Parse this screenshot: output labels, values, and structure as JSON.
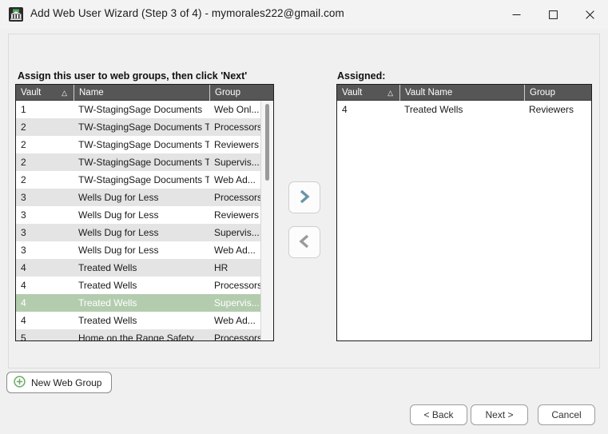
{
  "window": {
    "title": "Add Web User Wizard (Step 3 of 4) - mymorales222@gmail.com",
    "app_icon": "vault-building-icon",
    "controls": {
      "minimize": "minimize-icon",
      "maximize": "maximize-icon",
      "close": "close-icon"
    }
  },
  "left_panel": {
    "caption": "Assign this user to web groups, then click 'Next'",
    "columns": [
      "Vault",
      "Name",
      "Group"
    ],
    "sort_indicator": "△",
    "rows": [
      {
        "vault": "1",
        "name": "TW-StagingSage Documents",
        "group": "Web Onl...",
        "selected": false
      },
      {
        "vault": "2",
        "name": "TW-StagingSage Documents Test",
        "group": "Processors",
        "selected": false
      },
      {
        "vault": "2",
        "name": "TW-StagingSage Documents Test",
        "group": "Reviewers",
        "selected": false
      },
      {
        "vault": "2",
        "name": "TW-StagingSage Documents Test",
        "group": "Supervis...",
        "selected": false
      },
      {
        "vault": "2",
        "name": "TW-StagingSage Documents Test",
        "group": "Web Ad...",
        "selected": false
      },
      {
        "vault": "3",
        "name": "Wells Dug for Less",
        "group": "Processors",
        "selected": false
      },
      {
        "vault": "3",
        "name": "Wells Dug for Less",
        "group": "Reviewers",
        "selected": false
      },
      {
        "vault": "3",
        "name": "Wells Dug for Less",
        "group": "Supervis...",
        "selected": false
      },
      {
        "vault": "3",
        "name": "Wells Dug for Less",
        "group": "Web Ad...",
        "selected": false
      },
      {
        "vault": "4",
        "name": "Treated Wells",
        "group": "HR",
        "selected": false
      },
      {
        "vault": "4",
        "name": "Treated Wells",
        "group": "Processors",
        "selected": false
      },
      {
        "vault": "4",
        "name": "Treated Wells",
        "group": "Supervis...",
        "selected": true
      },
      {
        "vault": "4",
        "name": "Treated Wells",
        "group": "Web Ad...",
        "selected": false
      },
      {
        "vault": "5",
        "name": "Home on the Range Safety",
        "group": "Processors",
        "selected": false
      }
    ],
    "scrollbar": "vertical-scrollbar"
  },
  "right_panel": {
    "caption": "Assigned:",
    "columns": [
      "Vault",
      "Vault Name",
      "Group"
    ],
    "sort_indicator": "△",
    "rows": [
      {
        "vault": "4",
        "name": "Treated Wells",
        "group": "Reviewers"
      }
    ]
  },
  "transfer": {
    "assign_icon": "chevron-right-icon",
    "unassign_icon": "chevron-left-icon",
    "assign_color": "#6c93a8",
    "unassign_color": "#9a9a9a"
  },
  "actions": {
    "new_web_group": "New Web Group",
    "new_web_group_icon": "plus-circle-icon",
    "back": "< Back",
    "next": "Next >",
    "cancel": "Cancel"
  },
  "colors": {
    "selected_row": "#b3ccae",
    "header_bar": "#565656",
    "alt_row": "#e4e4e4",
    "accent_green": "#6aaa64",
    "window_bg": "#f0f0f0"
  }
}
